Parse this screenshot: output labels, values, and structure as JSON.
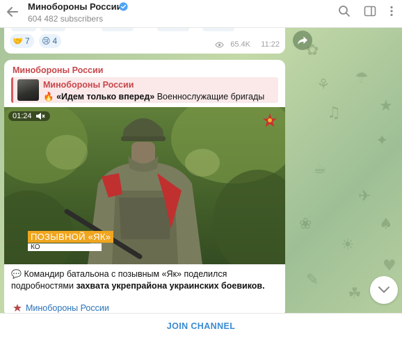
{
  "header": {
    "channel_name": "Минобороны России",
    "subscribers": "604 482 subscribers",
    "icons": [
      "back-arrow-icon",
      "verified-badge-icon",
      "search-icon",
      "sidebar-toggle-icon",
      "more-vertical-icon"
    ]
  },
  "previous_message": {
    "reactions": [
      {
        "emoji": "🤝",
        "icon": "handshake-emoji",
        "count": "7"
      },
      {
        "emoji": "😢",
        "icon": "crying-face-emoji",
        "count": "4"
      }
    ],
    "views": "65.4K",
    "time": "11:22"
  },
  "post": {
    "author": "Минобороны России",
    "forward": {
      "name": "Минобороны России",
      "title": "«Идем только вперед»",
      "text": "Военнослужащие бригады"
    },
    "video": {
      "duration": "01:24",
      "caption_main": "ПОЗЫВНОЙ «ЯК»",
      "caption_sub": "КО"
    },
    "text_part1": "Командир батальона с позывным «Як» поделился подробностями",
    "text_bold": "захвата укрепрайона украинских боевиков.",
    "signature": "Минобороны России"
  },
  "join_label": "JOIN CHANNEL",
  "colors": {
    "accent_blue": "#3a8bd1",
    "author_red": "#c8474b",
    "callsign_orange": "#f0a51e",
    "chat_green": "#a8c49a"
  }
}
